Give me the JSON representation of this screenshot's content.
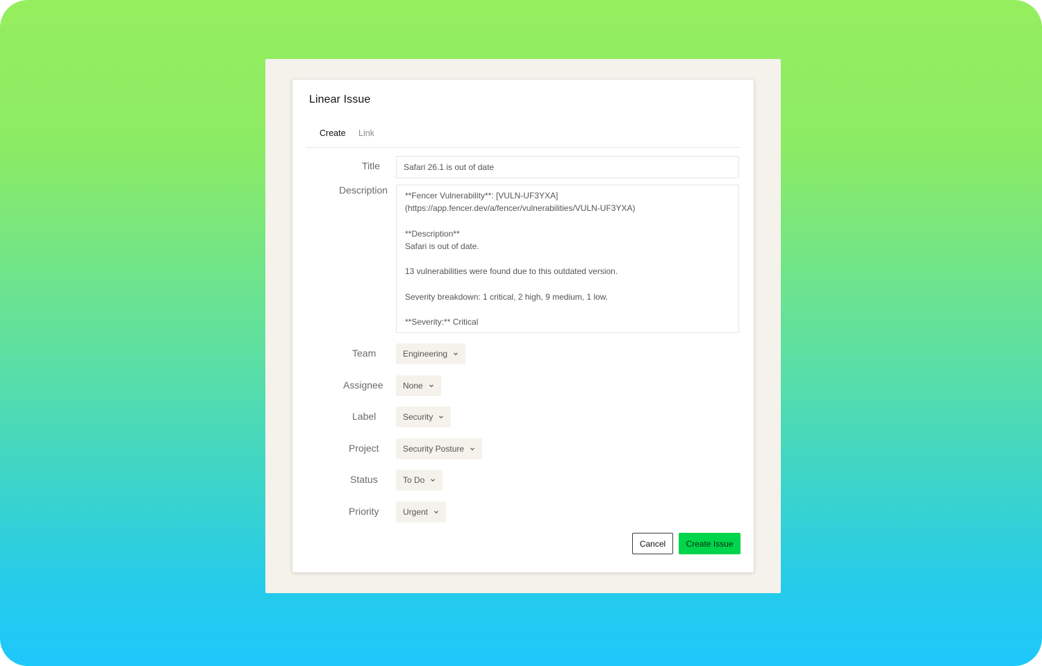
{
  "dialog": {
    "title": "Linear Issue"
  },
  "tabs": [
    {
      "label": "Create",
      "active": true
    },
    {
      "label": "Link",
      "active": false
    }
  ],
  "form": {
    "title_label": "Title",
    "title_value": "Safari 26.1 is out of date",
    "description_label": "Description",
    "description_value": "**Fencer Vulnerability**: [VULN-UF3YXA]\n(https://app.fencer.dev/a/fencer/vulnerabilities/VULN-UF3YXA)\n\n**Description**\nSafari is out of date.\n\n13 vulnerabilities were found due to this outdated version.\n\nSeverity breakdown: 1 critical, 2 high, 9 medium, 1 low.\n\n**Severity:** Critical",
    "team": {
      "label": "Team",
      "value": "Engineering"
    },
    "assignee": {
      "label": "Assignee",
      "value": "None"
    },
    "label": {
      "label": "Label",
      "value": "Security"
    },
    "project": {
      "label": "Project",
      "value": "Security Posture"
    },
    "status": {
      "label": "Status",
      "value": "To Do"
    },
    "priority": {
      "label": "Priority",
      "value": "Urgent"
    }
  },
  "actions": {
    "cancel_label": "Cancel",
    "create_label": "Create Issue"
  },
  "icons": {
    "dropdown": "chevron-down-icon"
  },
  "colors": {
    "primary_button": "#00d54b",
    "panel_background": "#f5f2ec",
    "gradient_top": "#95ee5e",
    "gradient_bottom": "#1ec8fb"
  }
}
